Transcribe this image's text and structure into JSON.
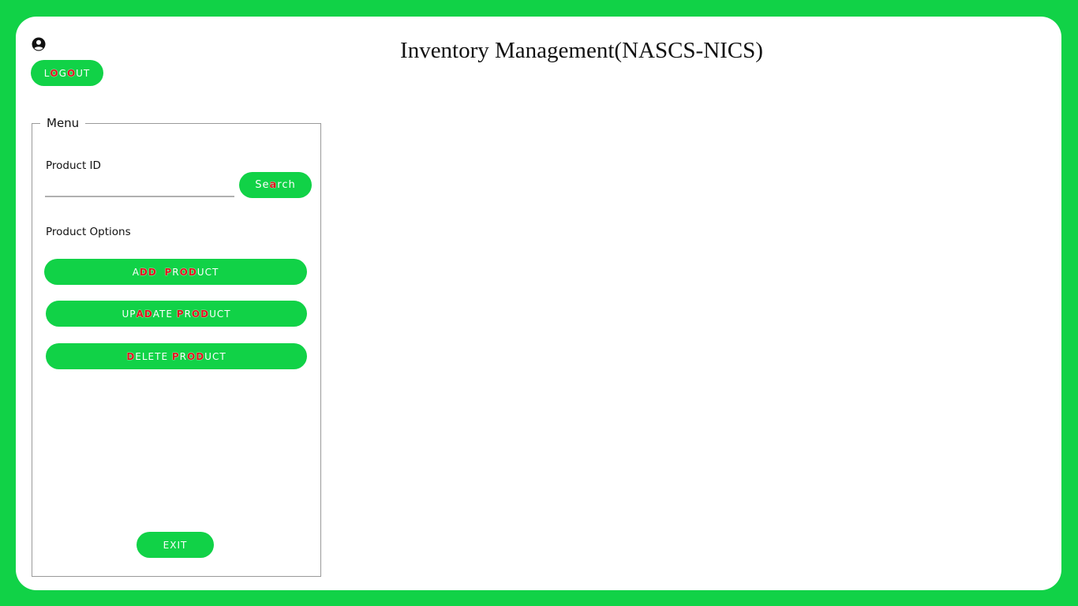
{
  "header": {
    "title": "Inventory Management(NASCS-NICS)",
    "user_icon": "user-circle-icon"
  },
  "colors": {
    "background": "#11d247",
    "accent": "#11d247",
    "highlight": "#e0141e",
    "card": "#ffffff"
  },
  "buttons": {
    "logout": {
      "segments": [
        [
          "L",
          false
        ],
        [
          "O",
          true
        ],
        [
          "G",
          false
        ],
        [
          "O",
          true
        ],
        [
          "UT",
          false
        ]
      ]
    },
    "search": {
      "segments": [
        [
          "Se",
          false
        ],
        [
          "a",
          true
        ],
        [
          "rch",
          false
        ]
      ]
    },
    "add_product": {
      "segments": [
        [
          "A",
          false
        ],
        [
          "DD",
          true
        ],
        [
          "  ",
          false
        ],
        [
          "P",
          true
        ],
        [
          "R",
          false
        ],
        [
          "OD",
          true
        ],
        [
          "UCT",
          false
        ]
      ]
    },
    "update_product": {
      "segments": [
        [
          "UP",
          false
        ],
        [
          "A",
          true
        ],
        [
          "D",
          true
        ],
        [
          "A",
          false
        ],
        [
          "TE ",
          false
        ],
        [
          "P",
          true
        ],
        [
          "R",
          false
        ],
        [
          "OD",
          true
        ],
        [
          "UCT",
          false
        ]
      ]
    },
    "delete_product": {
      "segments": [
        [
          "D",
          true
        ],
        [
          "ELETE ",
          false
        ],
        [
          "P",
          true
        ],
        [
          "R",
          false
        ],
        [
          "OD",
          true
        ],
        [
          "UCT",
          false
        ]
      ]
    },
    "exit": {
      "segments": [
        [
          "EXIT",
          false
        ]
      ]
    }
  },
  "menu": {
    "legend": "Menu",
    "product_id_label": "Product ID",
    "product_id_value": "",
    "product_options_label": "Product Options"
  }
}
